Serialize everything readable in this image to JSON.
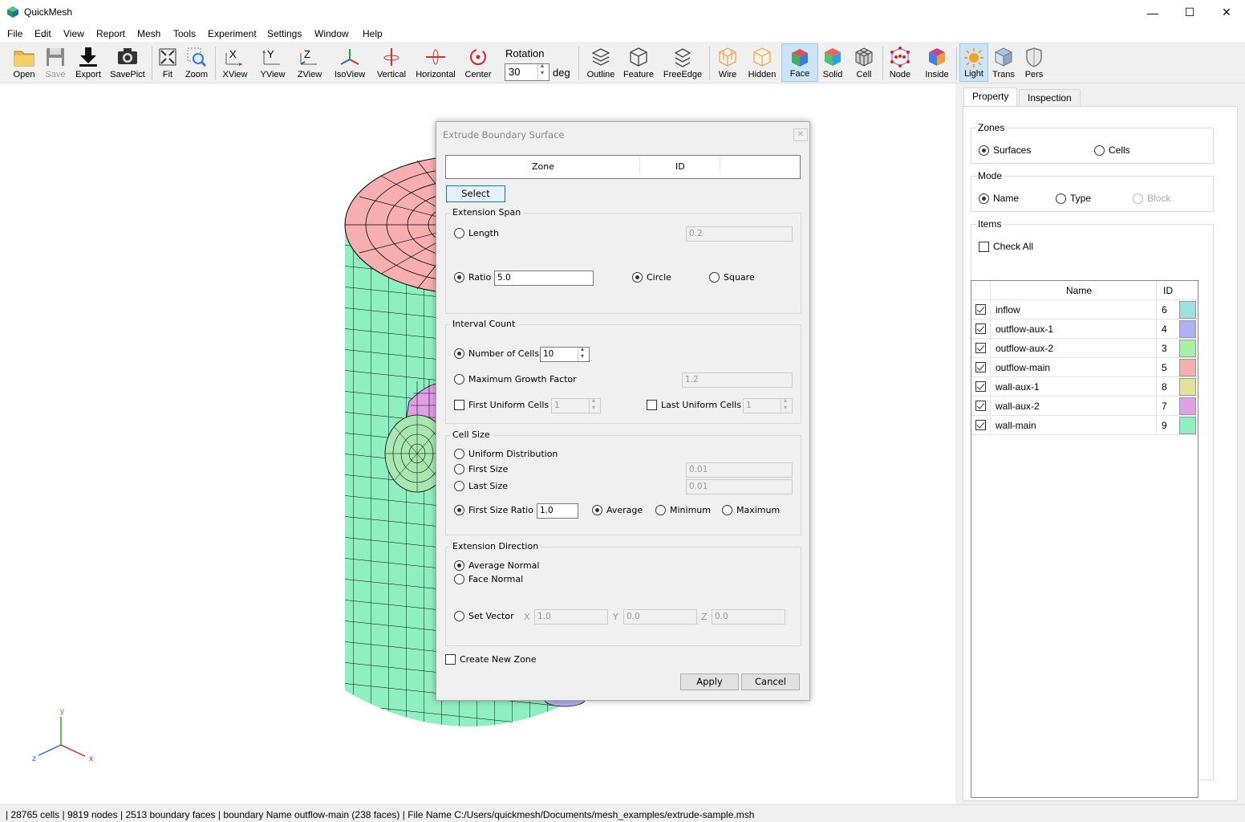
{
  "app": {
    "title": "QuickMesh"
  },
  "menu": [
    "File",
    "Edit",
    "View",
    "Report",
    "Mesh",
    "Tools",
    "Experiment",
    "Settings",
    "Window",
    "Help"
  ],
  "toolbar": {
    "open": "Open",
    "save": "Save",
    "export": "Export",
    "savepict": "SavePict",
    "fit": "Fit",
    "zoom": "Zoom",
    "xview": "XView",
    "yview": "YView",
    "zview": "ZView",
    "isoview": "IsoView",
    "vertical": "Vertical",
    "horizontal": "Horizontal",
    "center": "Center",
    "rotation_label": "Rotation",
    "rotation_value": "30",
    "rotation_unit": "deg",
    "outline": "Outline",
    "feature": "Feature",
    "freeedge": "FreeEdge",
    "wire": "Wire",
    "hidden": "Hidden",
    "face": "Face",
    "solid": "Solid",
    "cell": "Cell",
    "node": "Node",
    "inside": "Inside",
    "light": "Light",
    "trans": "Trans",
    "pers": "Pers"
  },
  "dialog": {
    "title": "Extrude Boundary Surface",
    "table_headers": [
      "Zone",
      "ID"
    ],
    "select_label": "Select",
    "extension_span": {
      "title": "Extension Span",
      "length_label": "Length",
      "length_value": "0.2",
      "ratio_label": "Ratio",
      "ratio_value": "5.0",
      "circle_label": "Circle",
      "square_label": "Square"
    },
    "interval_count": {
      "title": "Interval Count",
      "number_of_cells_label": "Number of Cells",
      "number_of_cells_value": "10",
      "max_growth_label": "Maximum Growth Factor",
      "max_growth_value": "1.2",
      "first_uniform_label": "First Uniform Cells",
      "first_uniform_value": "1",
      "last_uniform_label": "Last Uniform Cells",
      "last_uniform_value": "1"
    },
    "cell_size": {
      "title": "Cell Size",
      "uniform_label": "Uniform Distribution",
      "first_size_label": "First Size",
      "first_size_value": "0.01",
      "last_size_label": "Last Size",
      "last_size_value": "0.01",
      "first_size_ratio_label": "First Size Ratio",
      "first_size_ratio_value": "1.0",
      "average_label": "Average",
      "minimum_label": "Minimum",
      "maximum_label": "Maximum"
    },
    "extension_direction": {
      "title": "Extension Direction",
      "average_normal_label": "Average Normal",
      "face_normal_label": "Face Normal",
      "set_vector_label": "Set Vector",
      "x_label": "X",
      "x_value": "1.0",
      "y_label": "Y",
      "y_value": "0.0",
      "z_label": "Z",
      "z_value": "0.0"
    },
    "create_new_zone_label": "Create New Zone",
    "apply_label": "Apply",
    "cancel_label": "Cancel"
  },
  "panel": {
    "tabs": [
      "Property",
      "Inspection"
    ],
    "zones": {
      "title": "Zones",
      "surfaces_label": "Surfaces",
      "cells_label": "Cells"
    },
    "mode": {
      "title": "Mode",
      "name_label": "Name",
      "type_label": "Type",
      "block_label": "Block"
    },
    "items": {
      "title": "Items",
      "check_all_label": "Check All",
      "headers": [
        "Name",
        "ID"
      ],
      "rows": [
        {
          "name": "inflow",
          "id": "6",
          "color": "#9ee0e0"
        },
        {
          "name": "outflow-aux-1",
          "id": "4",
          "color": "#b0b0f5"
        },
        {
          "name": "outflow-aux-2",
          "id": "3",
          "color": "#a6f0a6"
        },
        {
          "name": "outflow-main",
          "id": "5",
          "color": "#f7aeae"
        },
        {
          "name": "wall-aux-1",
          "id": "8",
          "color": "#e2e29a"
        },
        {
          "name": "wall-aux-2",
          "id": "7",
          "color": "#e0a0e8"
        },
        {
          "name": "wall-main",
          "id": "9",
          "color": "#8ef0c0"
        }
      ]
    }
  },
  "axes": {
    "x": "x",
    "y": "y",
    "z": "z"
  },
  "status": {
    "text": "| 28765 cells | 9819 nodes | 2513 boundary faces |  boundary Name outflow-main (238 faces) | File Name C:/Users/quickmesh/Documents/mesh_examples/extrude-sample.msh"
  },
  "colors": {
    "accent": "#0078d7",
    "wall_main": "#8ef0c0",
    "outflow_main": "#f7aeae",
    "wall_aux_2": "#e0a0e8",
    "wall_aux_1": "#e2e29a"
  }
}
